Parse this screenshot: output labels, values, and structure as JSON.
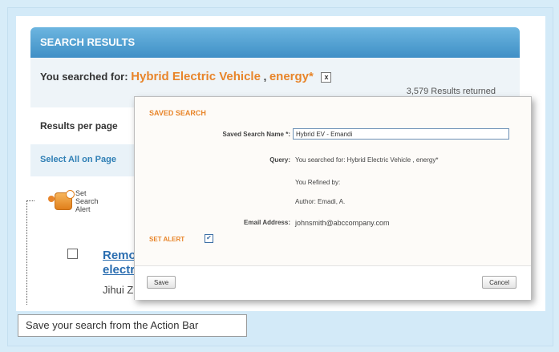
{
  "header": {
    "title": "SEARCH RESULTS"
  },
  "search": {
    "prefix": "You searched for:",
    "term1": "Hybrid Electric Vehicle",
    "separator": ",",
    "term2": "energy*",
    "remove_icon": "x",
    "returned": "3,579 Results returned"
  },
  "results_per_page": "Results per page",
  "select_all": "Select All on Page",
  "action_bar": {
    "set_search_alert": "Set Search Alert"
  },
  "result": {
    "title": "Remote electric",
    "author": "Jihui Zhu"
  },
  "modal": {
    "title": "SAVED SEARCH",
    "name_label": "Saved Search Name *:",
    "name_value": "Hybrid EV - Emandi",
    "query_label": "Query:",
    "query_value": "You searched for: Hybrid Electric Vehicle , energy*",
    "refined_by": "You Refined by:",
    "author_refine": "Author: Emadi, A.",
    "email_label": "Email Address:",
    "email_value": "johnsmith@abccompany.com",
    "set_alert": "SET ALERT",
    "set_alert_checked": "✔",
    "save_label": "Save",
    "cancel_label": "Cancel"
  },
  "callout": {
    "text": "Save your search from the Action Bar"
  },
  "colors": {
    "accent": "#e8852a",
    "header_blue": "#3f8fc6",
    "link_blue": "#2a6db0"
  }
}
